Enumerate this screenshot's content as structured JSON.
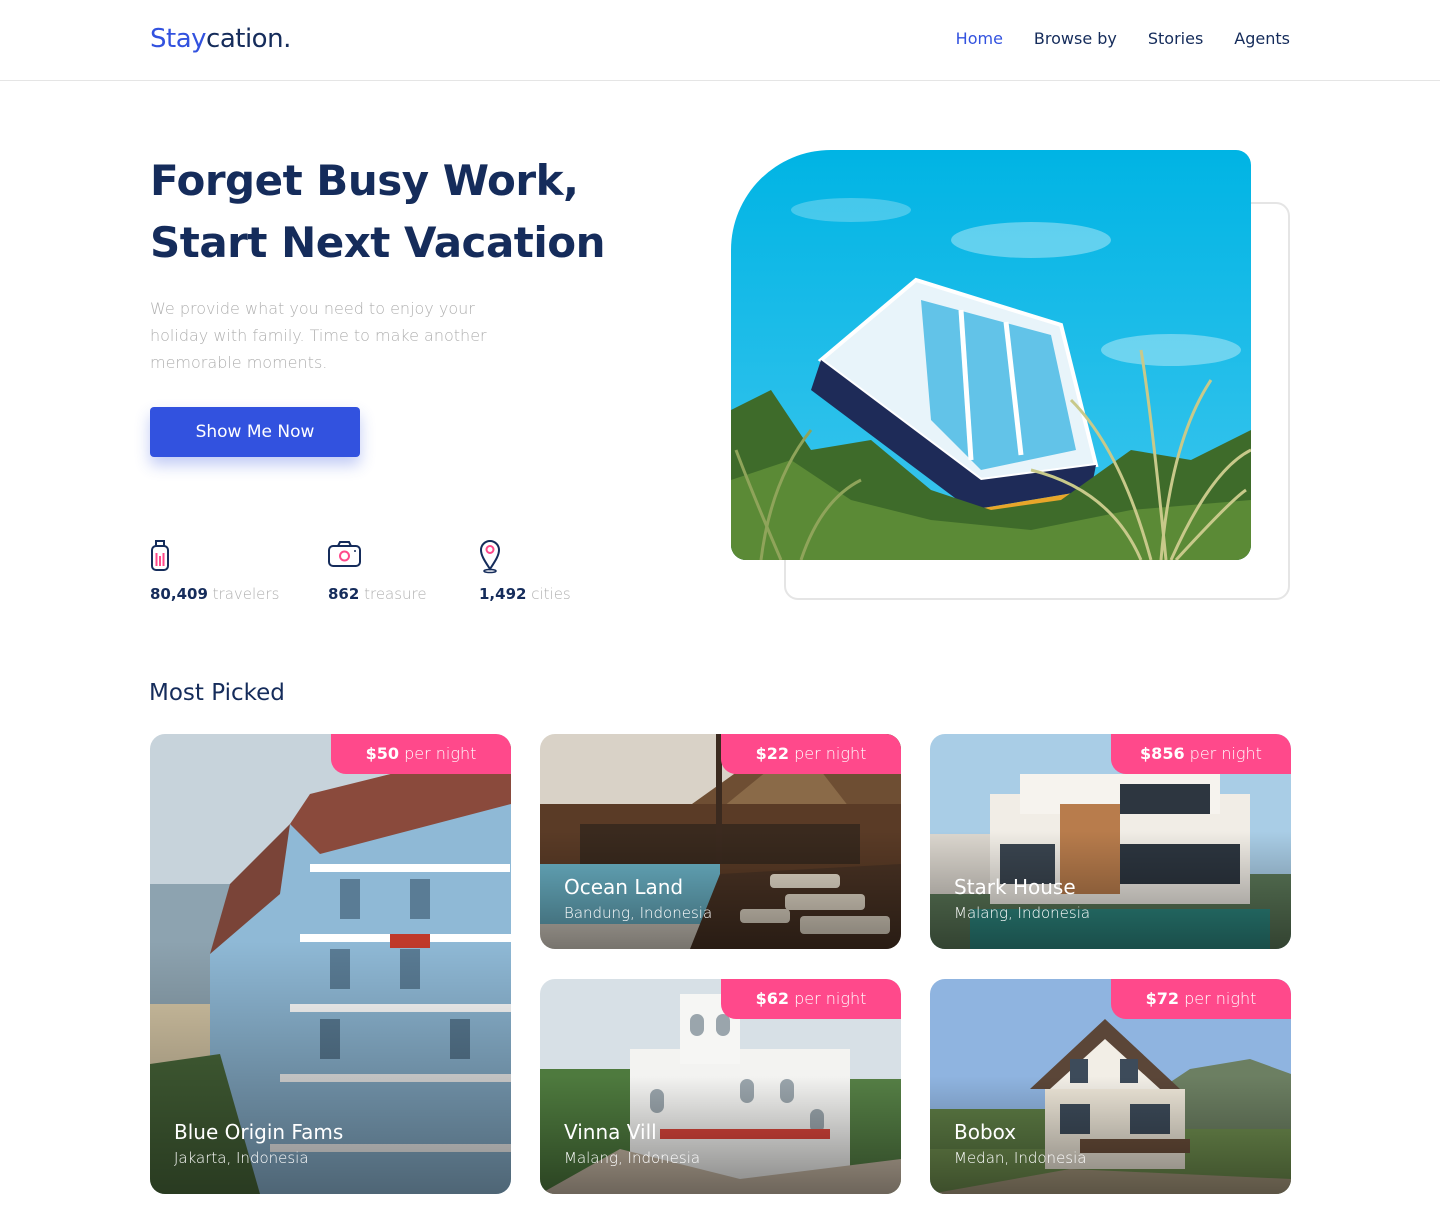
{
  "header": {
    "logo_part1": "Stay",
    "logo_part2": "cation.",
    "nav": [
      "Home",
      "Browse by",
      "Stories",
      "Agents"
    ],
    "active_nav": "Home"
  },
  "hero": {
    "title_line1": "Forget Busy Work,",
    "title_line2": "Start Next Vacation",
    "description": "We provide what you need to enjoy your holiday with family. Time to make another memorable moments.",
    "cta_label": "Show Me Now",
    "stats": [
      {
        "icon": "luggage-icon",
        "value": "80,409",
        "label": "travelers"
      },
      {
        "icon": "camera-icon",
        "value": "862",
        "label": "treasure"
      },
      {
        "icon": "map-pin-icon",
        "value": "1,492",
        "label": "cities"
      }
    ]
  },
  "most_picked": {
    "title": "Most Picked",
    "per_night": "per night",
    "items": [
      {
        "price": "$50",
        "name": "Blue Origin Fams",
        "location": "Jakarta, Indonesia"
      },
      {
        "price": "$22",
        "name": "Ocean Land",
        "location": "Bandung, Indonesia"
      },
      {
        "price": "$856",
        "name": "Stark House",
        "location": "Malang, Indonesia"
      },
      {
        "price": "$62",
        "name": "Vinna Vill",
        "location": "Malang, Indonesia"
      },
      {
        "price": "$72",
        "name": "Bobox",
        "location": "Medan, Indonesia"
      }
    ]
  },
  "colors": {
    "primary": "#3252DF",
    "navy": "#152C5B",
    "muted": "#B0B0B0",
    "accent_pink": "#FF498B"
  }
}
